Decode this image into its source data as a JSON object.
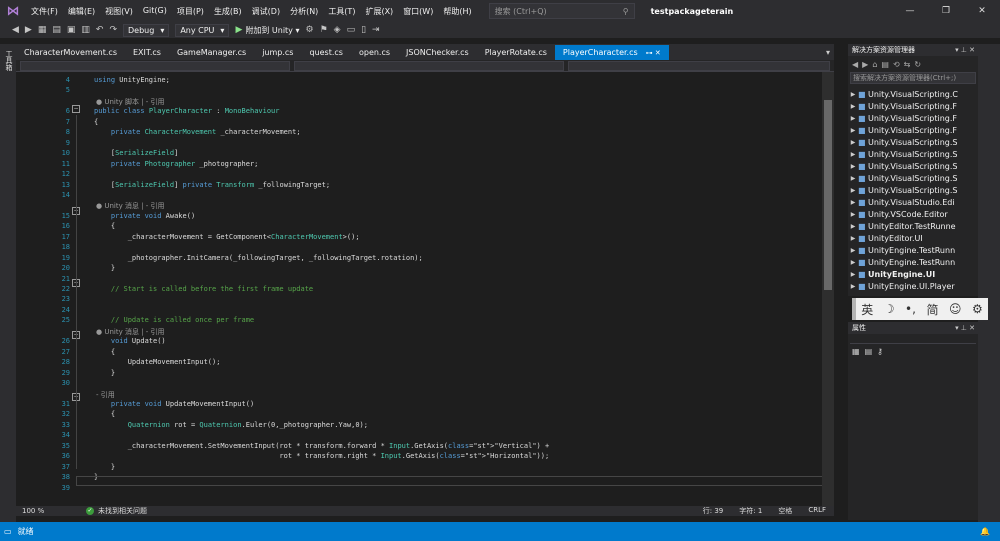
{
  "window": {
    "menu": [
      "文件(F)",
      "编辑(E)",
      "视图(V)",
      "Git(G)",
      "项目(P)",
      "生成(B)",
      "调试(D)",
      "分析(N)",
      "工具(T)",
      "扩展(X)",
      "窗口(W)",
      "帮助(H)"
    ],
    "search_placeholder": "搜索 (Ctrl+Q)",
    "project_name": "testpackageterain",
    "controls": {
      "minimize": "—",
      "maximize": "❐",
      "close": "✕"
    }
  },
  "toolbar": {
    "config": "Debug",
    "platform": "Any CPU",
    "run_label": "附加到 Unity ▾"
  },
  "left_rail": {
    "label": "工具箱"
  },
  "tabs": [
    {
      "label": "CharacterMovement.cs"
    },
    {
      "label": "EXIT.cs"
    },
    {
      "label": "GameManager.cs"
    },
    {
      "label": "jump.cs"
    },
    {
      "label": "quest.cs"
    },
    {
      "label": "open.cs"
    },
    {
      "label": "JSONChecker.cs"
    },
    {
      "label": "PlayerRotate.cs"
    },
    {
      "label": "PlayerCharacter.cs",
      "active": true
    }
  ],
  "editor": {
    "lines": [
      {
        "n": "4",
        "text": "using UnityEngine;"
      },
      {
        "n": "5",
        "text": ""
      },
      {
        "lens": "● Unity 脚本 | - 引用"
      },
      {
        "n": "6",
        "text": "public class PlayerCharacter : MonoBehaviour"
      },
      {
        "n": "7",
        "text": "{"
      },
      {
        "n": "8",
        "text": "    private CharacterMovement _characterMovement;"
      },
      {
        "n": "9",
        "text": ""
      },
      {
        "n": "10",
        "text": "    [SerializeField]"
      },
      {
        "n": "11",
        "text": "    private Photographer _photographer;"
      },
      {
        "n": "12",
        "text": ""
      },
      {
        "n": "13",
        "text": "    [SerializeField] private Transform _followingTarget;"
      },
      {
        "n": "14",
        "text": ""
      },
      {
        "lens": "    ● Unity 消息 | - 引用"
      },
      {
        "n": "15",
        "text": "    private void Awake()"
      },
      {
        "n": "16",
        "text": "    {"
      },
      {
        "n": "17",
        "text": "        _characterMovement = GetComponent<CharacterMovement>();"
      },
      {
        "n": "18",
        "text": ""
      },
      {
        "n": "19",
        "text": "        _photographer.InitCamera(_followingTarget, _followingTarget.rotation);"
      },
      {
        "n": "20",
        "text": "    }"
      },
      {
        "n": "21",
        "text": ""
      },
      {
        "n": "22",
        "text": "    // Start is called before the first frame update"
      },
      {
        "n": "23",
        "text": ""
      },
      {
        "n": "24",
        "text": ""
      },
      {
        "n": "25",
        "text": "    // Update is called once per frame"
      },
      {
        "lens": "    ● Unity 消息 | - 引用"
      },
      {
        "n": "26",
        "text": "    void Update()"
      },
      {
        "n": "27",
        "text": "    {"
      },
      {
        "n": "28",
        "text": "        UpdateMovementInput();"
      },
      {
        "n": "29",
        "text": "    }"
      },
      {
        "n": "30",
        "text": ""
      },
      {
        "lens": "    - 引用"
      },
      {
        "n": "31",
        "text": "    private void UpdateMovementInput()"
      },
      {
        "n": "32",
        "text": "    {"
      },
      {
        "n": "33",
        "text": "        Quaternion rot = Quaternion.Euler(0,_photographer.Yaw,0);"
      },
      {
        "n": "34",
        "text": ""
      },
      {
        "n": "35",
        "text": "        _characterMovement.SetMovementInput(rot * transform.forward * Input.GetAxis(\"Vertical\") +"
      },
      {
        "n": "36",
        "text": "                                            rot * transform.right * Input.GetAxis(\"Horizontal\"));"
      },
      {
        "n": "37",
        "text": "    }"
      },
      {
        "n": "38",
        "text": "}"
      },
      {
        "n": "39",
        "text": ""
      }
    ]
  },
  "editor_status": {
    "zoom": "100 %",
    "issues": "未找到相关问题",
    "line": "行: 39",
    "char": "字符: 1",
    "spaces": "空格",
    "eol": "CRLF"
  },
  "solution_explorer": {
    "title": "解决方案资源管理器",
    "search_placeholder": "搜索解决方案资源管理器(Ctrl+;)",
    "items": [
      {
        "label": "Unity.VisualScripting.C"
      },
      {
        "label": "Unity.VisualScripting.F"
      },
      {
        "label": "Unity.VisualScripting.F"
      },
      {
        "label": "Unity.VisualScripting.F"
      },
      {
        "label": "Unity.VisualScripting.S"
      },
      {
        "label": "Unity.VisualScripting.S"
      },
      {
        "label": "Unity.VisualScripting.S"
      },
      {
        "label": "Unity.VisualScripting.S"
      },
      {
        "label": "Unity.VisualScripting.S"
      },
      {
        "label": "Unity.VisualStudio.Edi"
      },
      {
        "label": "Unity.VSCode.Editor"
      },
      {
        "label": "UnityEditor.TestRunne"
      },
      {
        "label": "UnityEditor.UI"
      },
      {
        "label": "UnityEngine.TestRunn"
      },
      {
        "label": "UnityEngine.TestRunn"
      },
      {
        "label": "UnityEngine.UI",
        "bold": true
      },
      {
        "label": "UnityEngine.UI.Player"
      }
    ]
  },
  "ime": {
    "items": [
      "英",
      "☽",
      "•,",
      "简",
      "☺",
      "⚙"
    ]
  },
  "properties": {
    "title": "属性"
  },
  "statusbar": {
    "ready": "就绪"
  }
}
